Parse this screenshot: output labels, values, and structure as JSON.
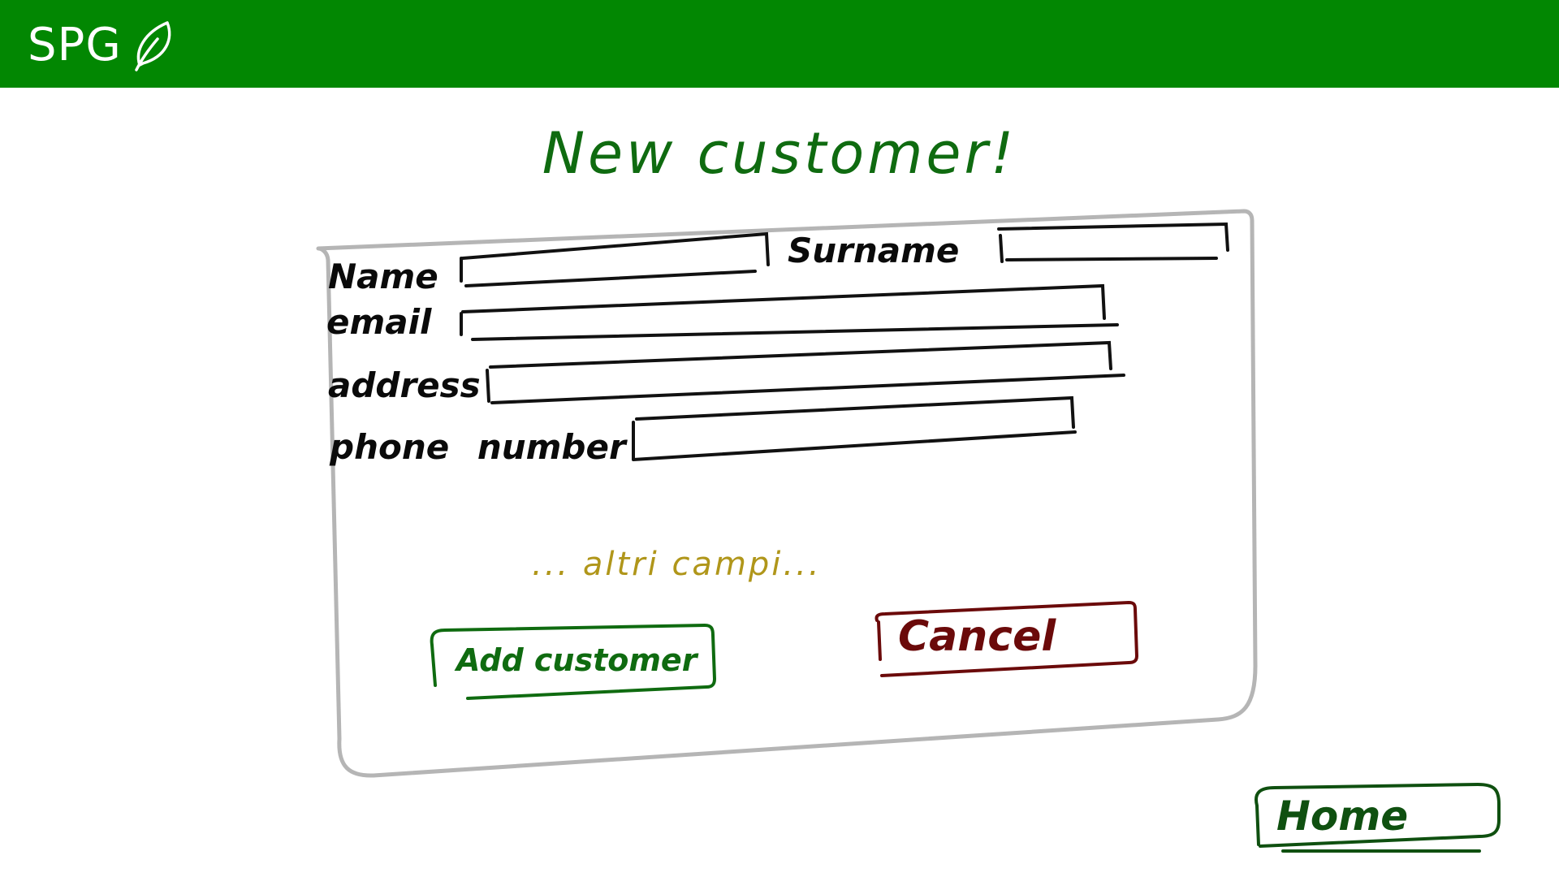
{
  "header": {
    "brand": "SPG",
    "brand_icon": "leaf-icon",
    "background": "#028702"
  },
  "page": {
    "title": "New customer!"
  },
  "form": {
    "fields": {
      "name_label": "Name",
      "surname_label": "Surname",
      "email_label": "email",
      "address_label": "address",
      "phone_label": "phone number"
    },
    "more_fields_note": "... altri campi...",
    "add_button_label": "Add customer",
    "cancel_button_label": "Cancel"
  },
  "footer": {
    "home_button_label": "Home"
  },
  "colors": {
    "title": "#0f6b10",
    "add_button": "#0f6b10",
    "cancel_button": "#6b0a0a",
    "home_button": "#0f5010",
    "note": "#b0961a",
    "form_border": "#b5b5b5"
  }
}
